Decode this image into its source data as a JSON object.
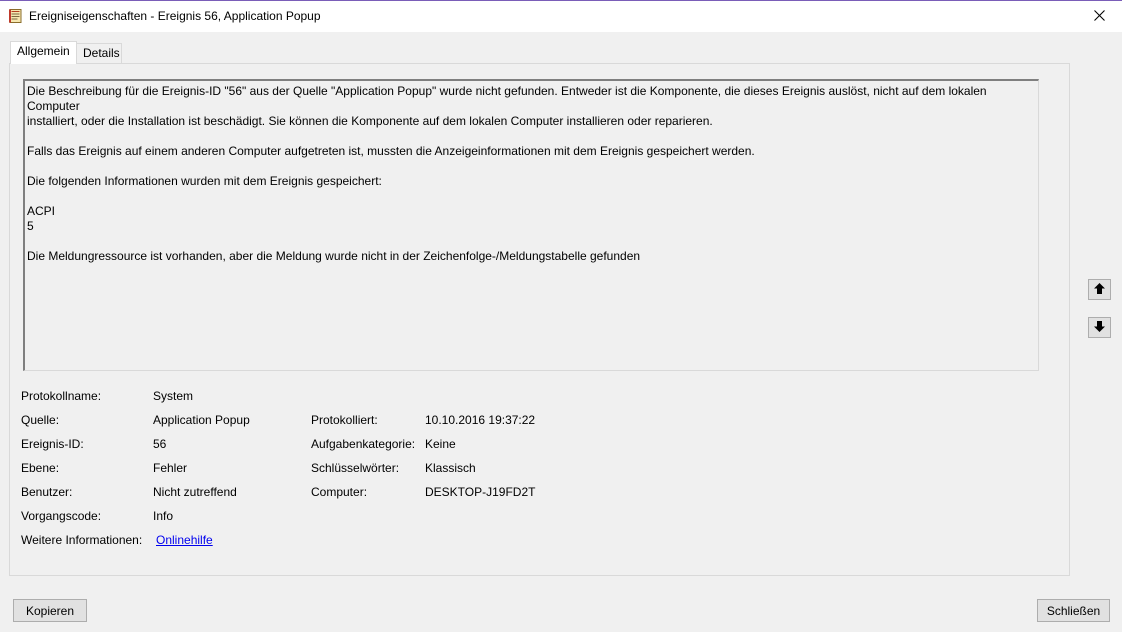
{
  "window": {
    "title": "Ereigniseigenschaften - Ereignis 56, Application Popup",
    "icon": "event-log-icon",
    "close_icon": "close-icon"
  },
  "tabs": [
    {
      "label": "Allgemein",
      "active": true
    },
    {
      "label": "Details",
      "active": false
    }
  ],
  "description": {
    "lines": [
      "Die Beschreibung für die Ereignis-ID \"56\" aus der Quelle \"Application Popup\" wurde nicht gefunden. Entweder ist die Komponente, die dieses Ereignis auslöst, nicht auf dem lokalen Computer",
      "installiert, oder die Installation ist beschädigt. Sie können die Komponente auf dem lokalen Computer installieren oder reparieren.",
      "Falls das Ereignis auf einem anderen Computer aufgetreten ist, mussten die Anzeigeinformationen mit dem Ereignis gespeichert werden.",
      "Die folgenden Informationen wurden mit dem Ereignis gespeichert:",
      "ACPI",
      "5",
      "Die Meldungressource ist vorhanden, aber die Meldung wurde nicht in der Zeichenfolge-/Meldungstabelle gefunden"
    ]
  },
  "properties": {
    "log_name_label": "Protokollname:",
    "log_name_value": "System",
    "source_label": "Quelle:",
    "source_value": "Application Popup",
    "logged_label": "Protokolliert:",
    "logged_value": "10.10.2016 19:37:22",
    "event_id_label": "Ereignis-ID:",
    "event_id_value": "56",
    "task_category_label": "Aufgabenkategorie:",
    "task_category_value": "Keine",
    "level_label": "Ebene:",
    "level_value": "Fehler",
    "keywords_label": "Schlüsselwörter:",
    "keywords_value": "Klassisch",
    "user_label": "Benutzer:",
    "user_value": "Nicht zutreffend",
    "computer_label": "Computer:",
    "computer_value": "DESKTOP-J19FD2T",
    "opcode_label": "Vorgangscode:",
    "opcode_value": "Info",
    "more_info_label": "Weitere Informationen:",
    "more_info_link": "Onlinehilfe"
  },
  "navigation": {
    "up_icon": "arrow-up-icon",
    "down_icon": "arrow-down-icon"
  },
  "buttons": {
    "copy": "Kopieren",
    "close": "Schließen"
  }
}
